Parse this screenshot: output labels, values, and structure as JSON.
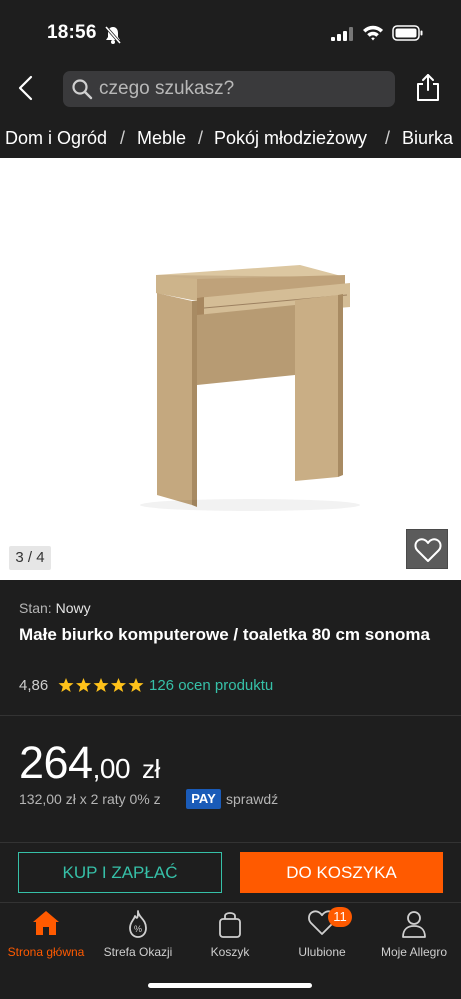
{
  "status_bar": {
    "time": "18:56"
  },
  "search": {
    "placeholder": "czego szukasz?"
  },
  "breadcrumbs": [
    "Dom i Ogród",
    "Meble",
    "Pokój młodzieżowy",
    "Biurka"
  ],
  "gallery": {
    "counter": "3 / 4"
  },
  "product": {
    "state_label": "Stan:",
    "state_value": "Nowy",
    "title": "Małe biurko komputerowe / toaletka 80 cm sonoma",
    "rating": "4,86",
    "stars": 5,
    "reviews": "126 ocen produktu"
  },
  "price": {
    "integer": "264",
    "decimal": ",00",
    "currency": "zł",
    "installments": "132,00 zł x 2 raty 0% z",
    "pay_badge": "PAY",
    "check_link": "sprawdź"
  },
  "actions": {
    "buy_now": "KUP I ZAPŁAĆ",
    "add_to_cart": "DO KOSZYKA"
  },
  "tabs": [
    {
      "label": "Strona główna",
      "icon": "home-icon",
      "active": true
    },
    {
      "label": "Strefa Okazji",
      "icon": "deals-icon"
    },
    {
      "label": "Koszyk",
      "icon": "cart-icon"
    },
    {
      "label": "Ulubione",
      "icon": "heart-icon",
      "badge": "11"
    },
    {
      "label": "Moje Allegro",
      "icon": "user-icon"
    }
  ],
  "colors": {
    "accent": "#ff5a00",
    "teal": "#36c0a8",
    "background": "#1e1e1e",
    "pay_blue": "#1a5bb8",
    "star": "#ffc21a"
  }
}
